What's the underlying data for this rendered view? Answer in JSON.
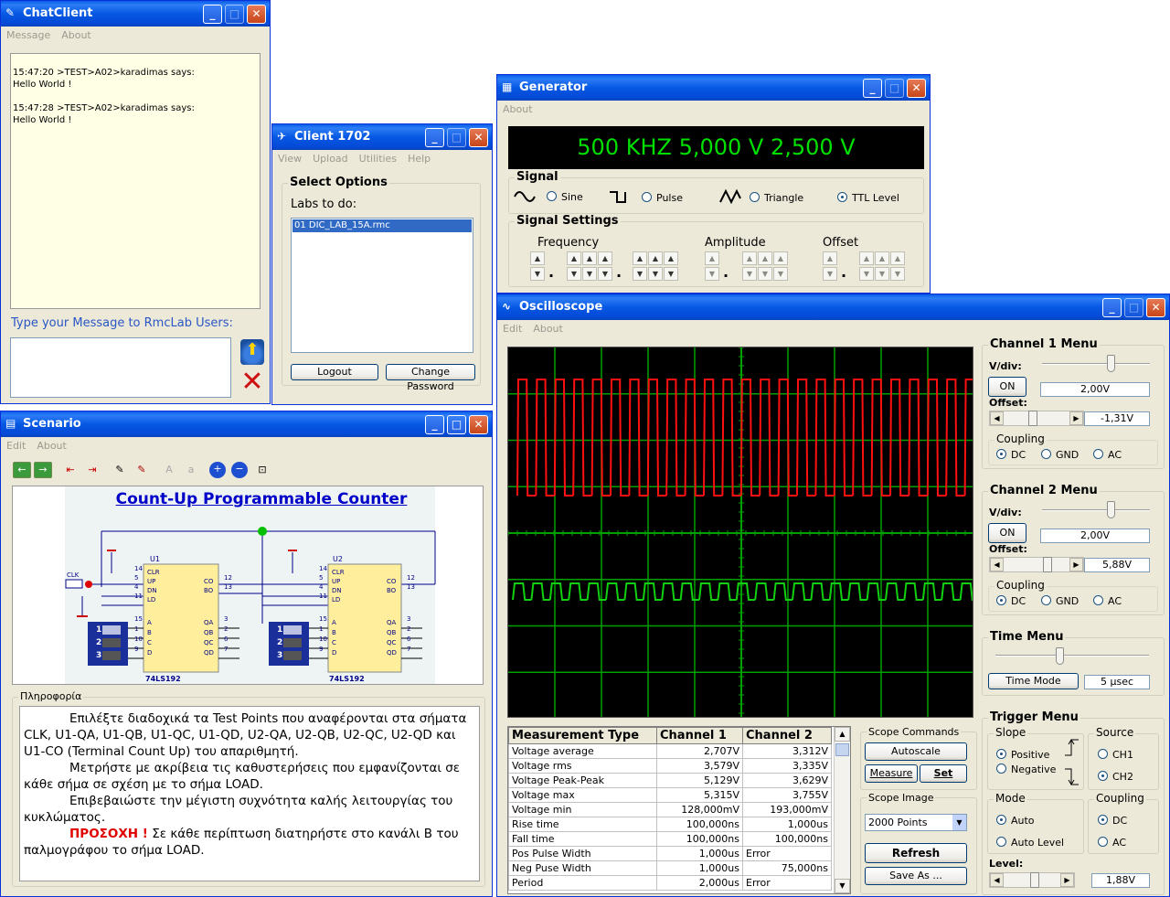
{
  "chat": {
    "title": "ChatClient",
    "menu": [
      "Message",
      "About"
    ],
    "log": [
      "15:47:20 >TEST>A02>karadimas says:",
      "Hello World !",
      "15:47:28 >TEST>A02>karadimas says:",
      "Hello World !"
    ],
    "prompt": "Type your Message to RmcLab Users:",
    "message_value": ""
  },
  "client": {
    "title": "Client 1702",
    "menu": [
      "View",
      "Upload",
      "Utilities",
      "Help"
    ],
    "group": "Select Options",
    "labs_label": "Labs to do:",
    "labs": [
      "01 DIC_LAB_15A.rmc"
    ],
    "logout": "Logout",
    "change_password": "Change Password"
  },
  "generator": {
    "title": "Generator",
    "menu": [
      "About"
    ],
    "display": "500 KHZ 5,000 V 2,500 V",
    "signal_group": "Signal",
    "waves": [
      "Sine",
      "Pulse",
      "Triangle",
      "TTL Level"
    ],
    "selected_wave": "TTL Level",
    "settings_group": "Signal Settings",
    "frequency": "Frequency",
    "amplitude": "Amplitude",
    "offset": "Offset"
  },
  "scenario": {
    "title": "Scenario",
    "menu": [
      "Edit",
      "About"
    ],
    "diagram_title": "Count-Up Programmable Counter",
    "u1": "U1",
    "u2": "U2",
    "chip": "74LS192",
    "clk": "CLK",
    "pins_left": [
      "CLR",
      "UP",
      "DN",
      "LD",
      "A",
      "B",
      "C",
      "D"
    ],
    "pins_left_num": [
      "14",
      "5",
      "4",
      "11",
      "15",
      "1",
      "10",
      "9"
    ],
    "pins_right": [
      "CO",
      "BO",
      "QA",
      "QB",
      "QC",
      "QD"
    ],
    "pins_right_num": [
      "12",
      "13",
      "3",
      "2",
      "6",
      "7"
    ],
    "dip": [
      "1",
      "2",
      "3"
    ],
    "info_label": "Πληροφορία",
    "p1": "Επιλέξτε διαδοχικά τα Test Points που αναφέρονται στα σήματα CLK, U1-QA, U1-QB, U1-QC, U1-QD, U2-QA, U2-QB, U2-QC, U2-QD και U1-CO (Terminal Count Up) του απαριθμητή.",
    "p2": "Μετρήστε με ακρίβεια τις καθυστερήσεις που εμφανίζονται σε κάθε σήμα σε σχέση με το σήμα LOAD.",
    "p3": "Επιβεβαιώστε την μέγιστη συχνότητα καλής λειτουργίας του κυκλώματος.",
    "warn": "ΠΡΟΣΟΧΗ !",
    "p4": " Σε κάθε περίπτωση διατηρήστε στο κανάλι B του παλμογράφου το σήμα LOAD."
  },
  "scope": {
    "title": "Oscilloscope",
    "menu": [
      "Edit",
      "About"
    ],
    "ch1": {
      "title": "Channel 1 Menu",
      "vdiv": "V/div:",
      "on": "ON",
      "vdiv_value": "2,00V",
      "offset": "Offset:",
      "offset_value": "-1,31V",
      "coupling": "Coupling",
      "c": [
        "DC",
        "GND",
        "AC"
      ],
      "sel": "DC"
    },
    "ch2": {
      "title": "Channel 2 Menu",
      "vdiv": "V/div:",
      "on": "ON",
      "vdiv_value": "2,00V",
      "offset": "Offset:",
      "offset_value": "5,88V",
      "coupling": "Coupling",
      "c": [
        "DC",
        "GND",
        "AC"
      ],
      "sel": "DC"
    },
    "time": {
      "title": "Time Menu",
      "mode": "Time Mode",
      "value": "5 μsec"
    },
    "trig": {
      "title": "Trigger Menu",
      "slope": "Slope",
      "positive": "Positive",
      "negative": "Negative",
      "source": "Source",
      "ch1": "CH1",
      "ch2": "CH2",
      "mode": "Mode",
      "auto": "Auto",
      "auto_level": "Auto Level",
      "coupling": "Coupling",
      "dc": "DC",
      "ac": "AC",
      "level": "Level:",
      "level_value": "1,88V"
    },
    "commands": {
      "title": "Scope Commands",
      "autoscale": "Autoscale",
      "measure": "Measure",
      "set": "Set"
    },
    "image": {
      "title": "Scope Image",
      "points": "2000  Points",
      "refresh": "Refresh",
      "save": "Save As ..."
    },
    "table": {
      "headers": [
        "Measurement Type",
        "Channel 1",
        "Channel 2"
      ],
      "rows": [
        [
          "Voltage average",
          "2,707V",
          "3,312V"
        ],
        [
          "Voltage rms",
          "3,579V",
          "3,335V"
        ],
        [
          "Voltage Peak-Peak",
          "5,129V",
          "3,629V"
        ],
        [
          "Voltage max",
          "5,315V",
          "3,755V"
        ],
        [
          "Voltage min",
          "128,000mV",
          "193,000mV"
        ],
        [
          "Rise time",
          "100,000ns",
          "1,000us"
        ],
        [
          "Fall time",
          "100,000ns",
          "100,000ns"
        ],
        [
          "Pos Pulse Width",
          "1,000us",
          "Error"
        ],
        [
          "Neg Puse Width",
          "1,000us",
          "75,000ns"
        ],
        [
          "Period",
          "2,000us",
          "Error"
        ]
      ]
    }
  },
  "colors": {
    "titlebar": "#0054e3",
    "ch1": "#ff0000",
    "ch2": "#00c000",
    "grid": "#00a000",
    "display_text": "#00e000"
  }
}
